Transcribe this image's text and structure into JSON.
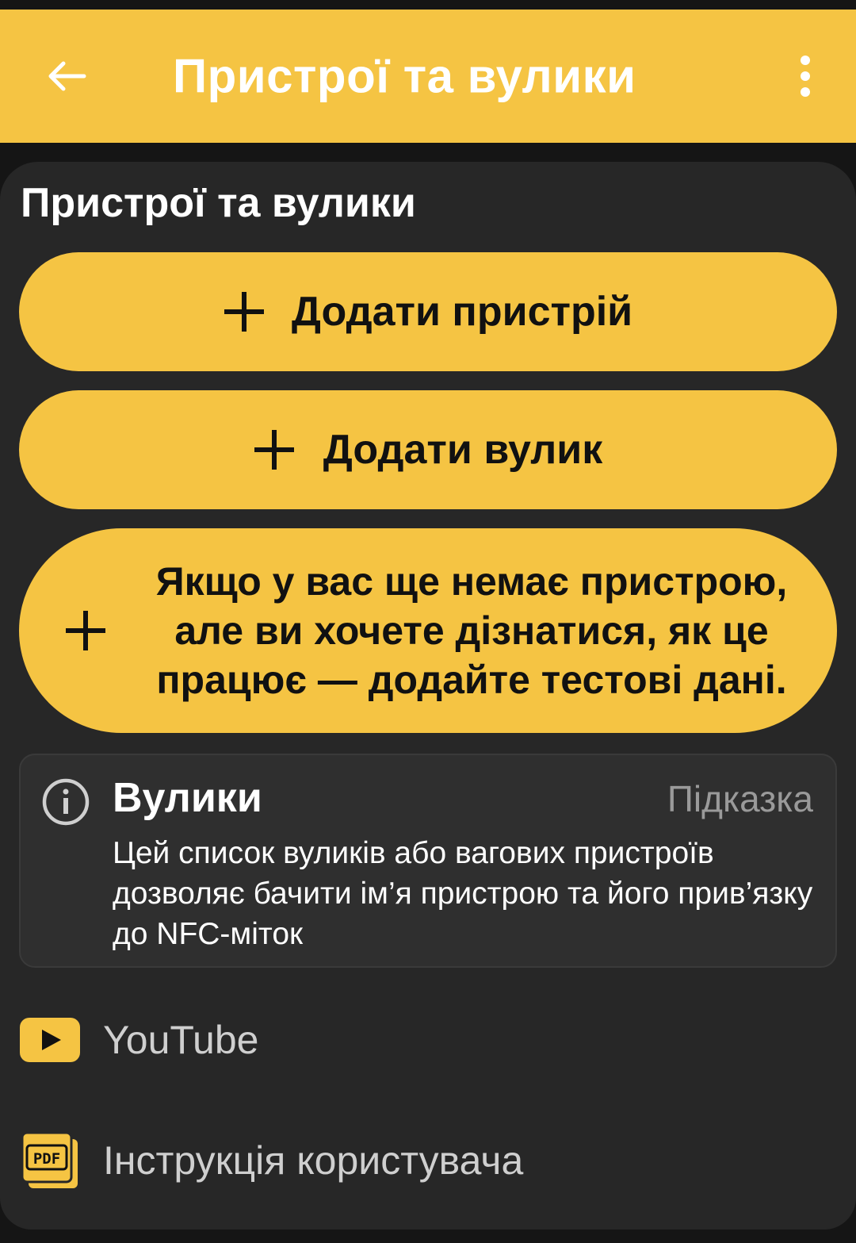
{
  "appbar": {
    "title": "Пристрої та вулики",
    "back_icon": "arrow-left-icon",
    "menu_icon": "more-vertical-icon"
  },
  "section": {
    "title": "Пристрої та вулики"
  },
  "actions": [
    {
      "label": "Додати пристрій",
      "icon": "plus-icon"
    },
    {
      "label": "Додати вулик",
      "icon": "plus-icon"
    },
    {
      "label": "Якщо у вас ще немає пристрою, але ви хочете дізнатися, як це працює — додайте тестові дані.",
      "icon": "plus-icon"
    }
  ],
  "hint": {
    "icon": "info-icon",
    "title": "Вулики",
    "tag": "Підказка",
    "text": "Цей список вуликів або вагових пристроїв дозволяє бачити ім’я пристрою та його прив’язку до NFC-міток"
  },
  "links": [
    {
      "label": "YouTube",
      "icon": "youtube-icon"
    },
    {
      "label": "Інструкція користувача",
      "icon": "pdf-icon",
      "icon_text": "PDF"
    }
  ],
  "colors": {
    "accent": "#F5C443",
    "background": "#151515",
    "card": "#272727",
    "hint_bg": "#2F2F2F"
  }
}
